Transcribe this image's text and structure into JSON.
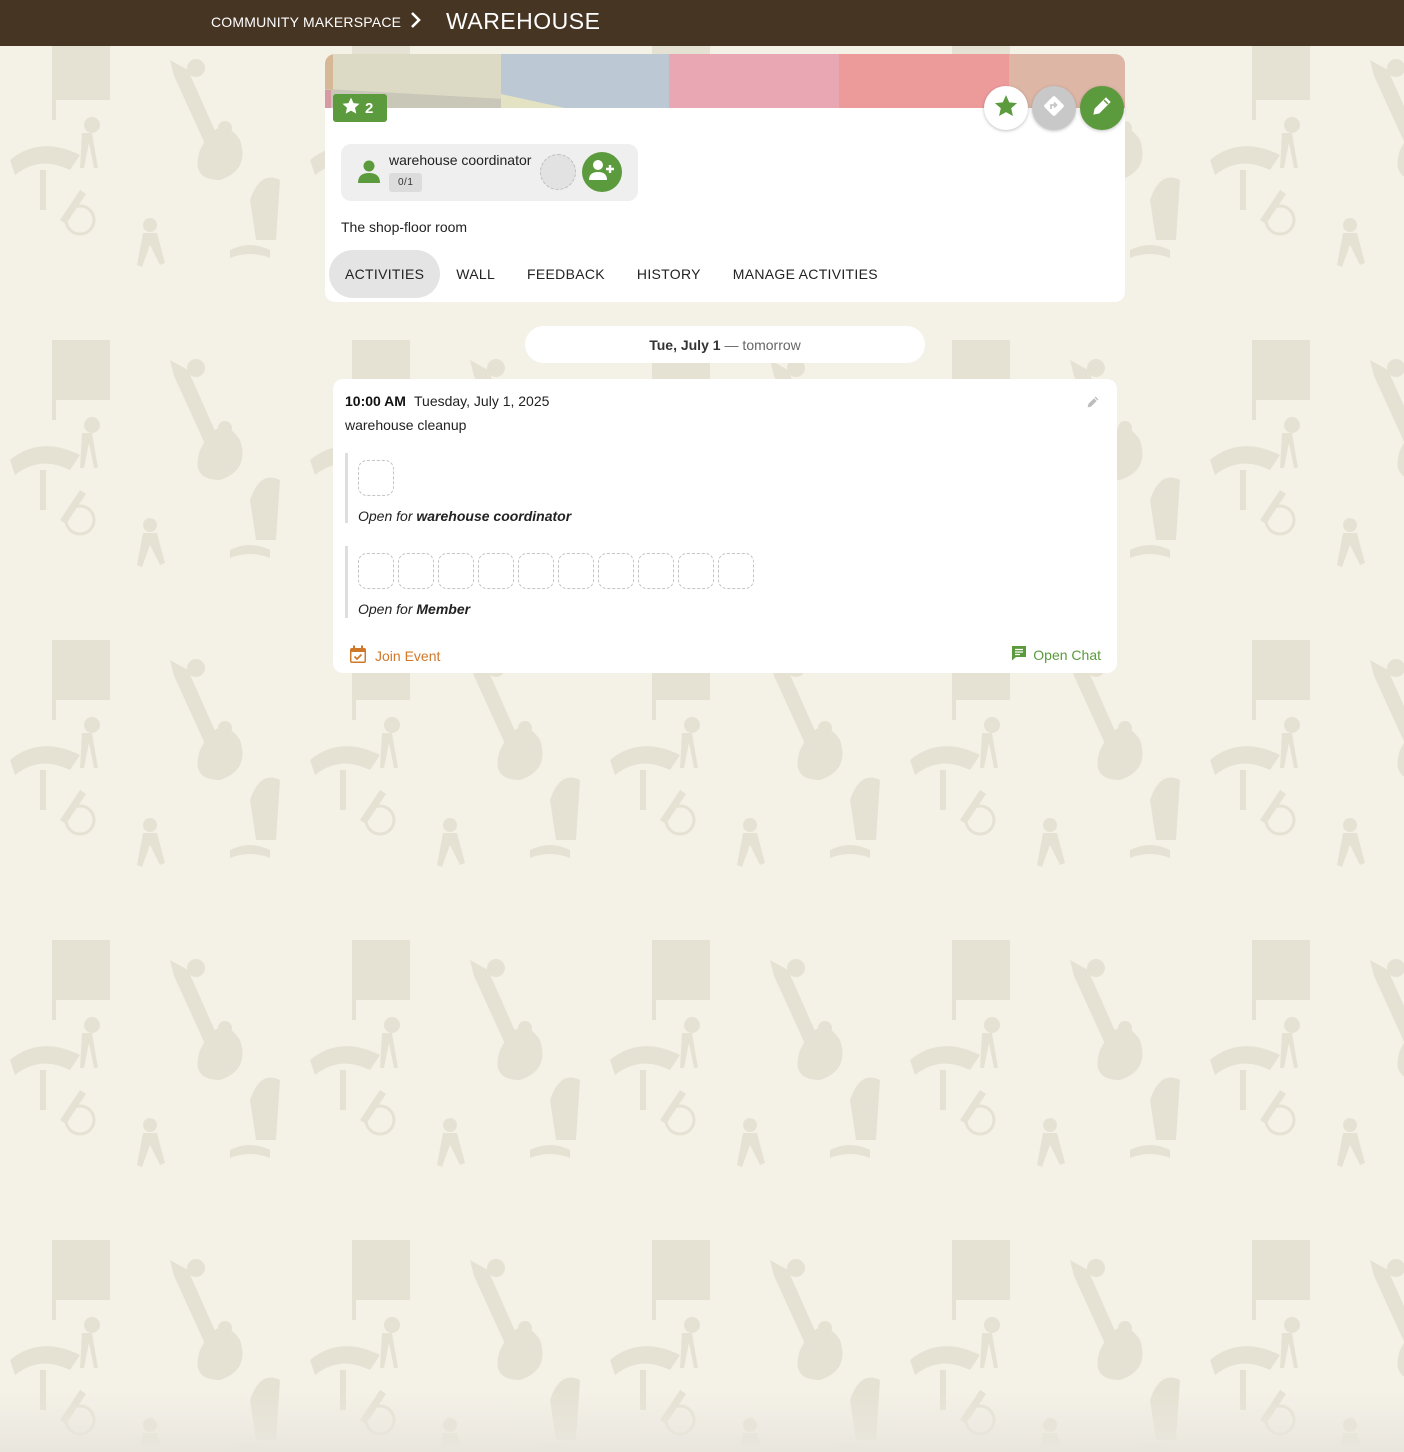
{
  "colors": {
    "topbar": "#473524",
    "background": "#f4f1e7",
    "accent_green": "#5b9a3d",
    "accent_orange": "#d0782a",
    "banner": [
      "#dcd9c4",
      "#bcc8d3",
      "#e9a7b3",
      "#ed9a9b",
      "#ddb6a6"
    ]
  },
  "breadcrumb": {
    "parent": "COMMUNITY MAKERSPACE",
    "current": "WAREHOUSE"
  },
  "header": {
    "star_count": "2",
    "role": {
      "name": "warehouse coordinator",
      "count": "0/1"
    },
    "description": "The shop-floor room",
    "tabs": [
      {
        "label": "ACTIVITIES",
        "active": true
      },
      {
        "label": "WALL",
        "active": false
      },
      {
        "label": "FEEDBACK",
        "active": false
      },
      {
        "label": "HISTORY",
        "active": false
      },
      {
        "label": "MANAGE ACTIVITIES",
        "active": false
      }
    ]
  },
  "date_divider": {
    "date": "Tue, July 1",
    "relative": "— tomorrow"
  },
  "event": {
    "time": "10:00 AM",
    "date": "Tuesday, July 1, 2025",
    "title": "warehouse cleanup",
    "groups": [
      {
        "open_prefix": "Open for",
        "role": "warehouse coordinator",
        "slots": 1
      },
      {
        "open_prefix": "Open for",
        "role": "Member",
        "slots": 10
      }
    ],
    "join_label": "Join Event",
    "chat_label": "Open Chat"
  },
  "icons": {
    "breadcrumb_separator": "chevron-right-icon",
    "star_badge": "star-icon",
    "favorite": "star-icon",
    "directions": "directions-icon",
    "edit": "pencil-icon",
    "role": "person-icon",
    "add_member": "add-person-icon",
    "event_edit": "pencil-icon",
    "join": "calendar-check-icon",
    "chat": "chat-icon"
  }
}
